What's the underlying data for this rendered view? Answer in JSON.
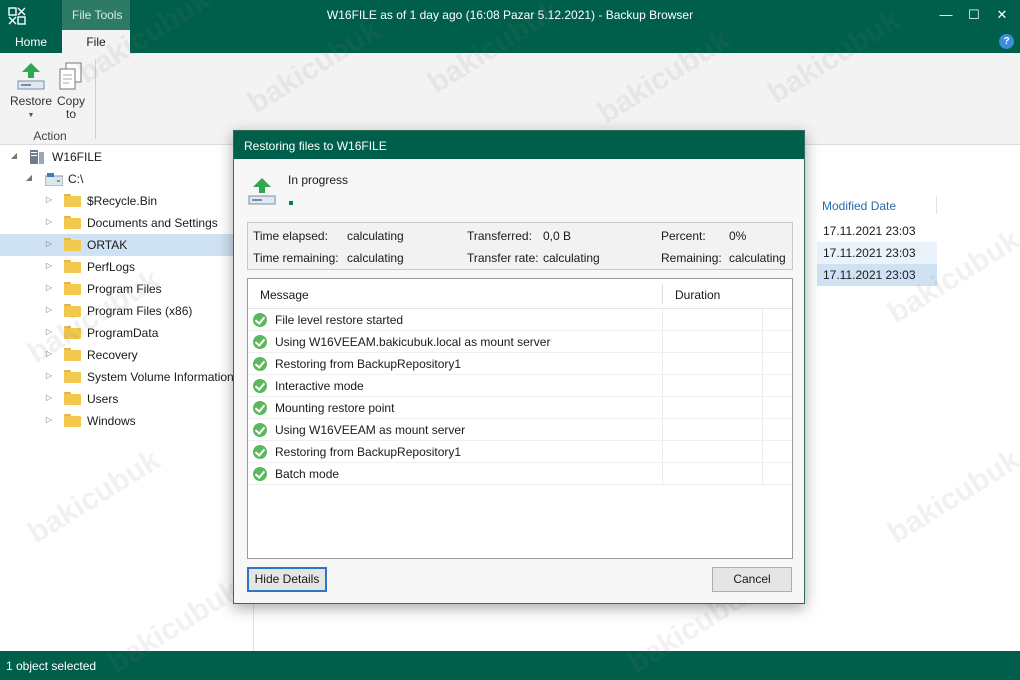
{
  "window": {
    "title": "W16FILE as of 1 day ago (16:08 Pazar 5.12.2021) - Backup Browser",
    "context_tab": "File Tools",
    "tabs": [
      "Home",
      "File"
    ],
    "minimize": "—",
    "maximize": "☐",
    "close": "✕",
    "help": "?"
  },
  "ribbon": {
    "restore_label": "Restore",
    "copy_label_1": "Copy",
    "copy_label_2": "to",
    "group_label": "Action"
  },
  "tree": {
    "root": "W16FILE",
    "drive": "C:\\",
    "folders": [
      "$Recycle.Bin",
      "Documents and Settings",
      "ORTAK",
      "PerfLogs",
      "Program Files",
      "Program Files (x86)",
      "ProgramData",
      "Recovery",
      "System Volume Information",
      "Users",
      "Windows"
    ],
    "selected_folder": "ORTAK"
  },
  "list": {
    "column_header": "Modified Date",
    "dates": [
      "17.11.2021 23:03",
      "17.11.2021 23:03",
      "17.11.2021 23:03"
    ]
  },
  "statusbar": {
    "text": "1 object selected"
  },
  "dialog": {
    "title": "Restoring files to W16FILE",
    "status": "In progress",
    "stats": {
      "time_elapsed_label": "Time elapsed:",
      "time_elapsed": "calculating",
      "transferred_label": "Transferred:",
      "transferred": "0,0 B",
      "percent_label": "Percent:",
      "percent": "0%",
      "time_remaining_label": "Time remaining:",
      "time_remaining": "calculating",
      "transfer_rate_label": "Transfer rate:",
      "transfer_rate": "calculating",
      "remaining_label": "Remaining:",
      "remaining": "calculating"
    },
    "grid": {
      "col_message": "Message",
      "col_duration": "Duration",
      "rows": [
        "File level restore started",
        "Using W16VEEAM.bakicubuk.local as mount server",
        "Restoring from BackupRepository1",
        "Interactive mode",
        "Mounting restore point",
        "Using W16VEEAM as mount server",
        "Restoring from BackupRepository1",
        "Batch mode"
      ]
    },
    "hide_details": "Hide Details",
    "cancel": "Cancel"
  },
  "watermark": "bakicubuk",
  "colors": {
    "brand_green": "#005f4b",
    "selection": "#cfe2f3",
    "success": "#5cb85c"
  }
}
